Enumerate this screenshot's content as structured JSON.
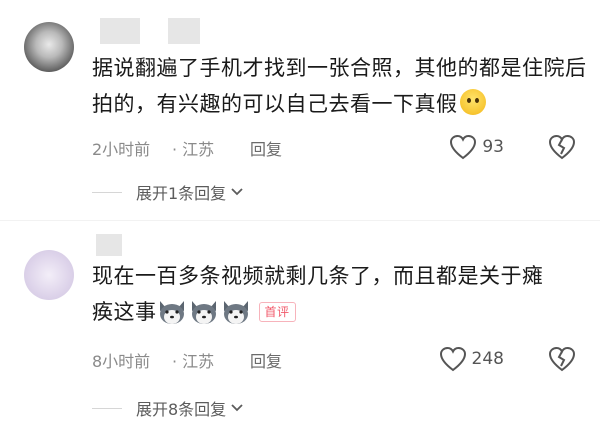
{
  "comments": [
    {
      "text": "据说翻遍了手机才找到一张合照，其他的都是住院后拍的，有兴趣的可以自己去看一下真假",
      "emoji": "thinking-emoji",
      "time": "2小时前",
      "location": "· 江苏",
      "reply_label": "回复",
      "like_count": "93",
      "expand_label": "展开1条回复"
    },
    {
      "text": "现在一百多条视频就剩几条了，而且都是关于瘫痪这事",
      "emoji": "husky-emoji",
      "tag": "首评",
      "time": "8小时前",
      "location": "· 江苏",
      "reply_label": "回复",
      "like_count": "248",
      "expand_label": "展开8条回复"
    }
  ],
  "colors": {
    "meta": "#8a8a8a",
    "tag": "#f15a6b"
  }
}
